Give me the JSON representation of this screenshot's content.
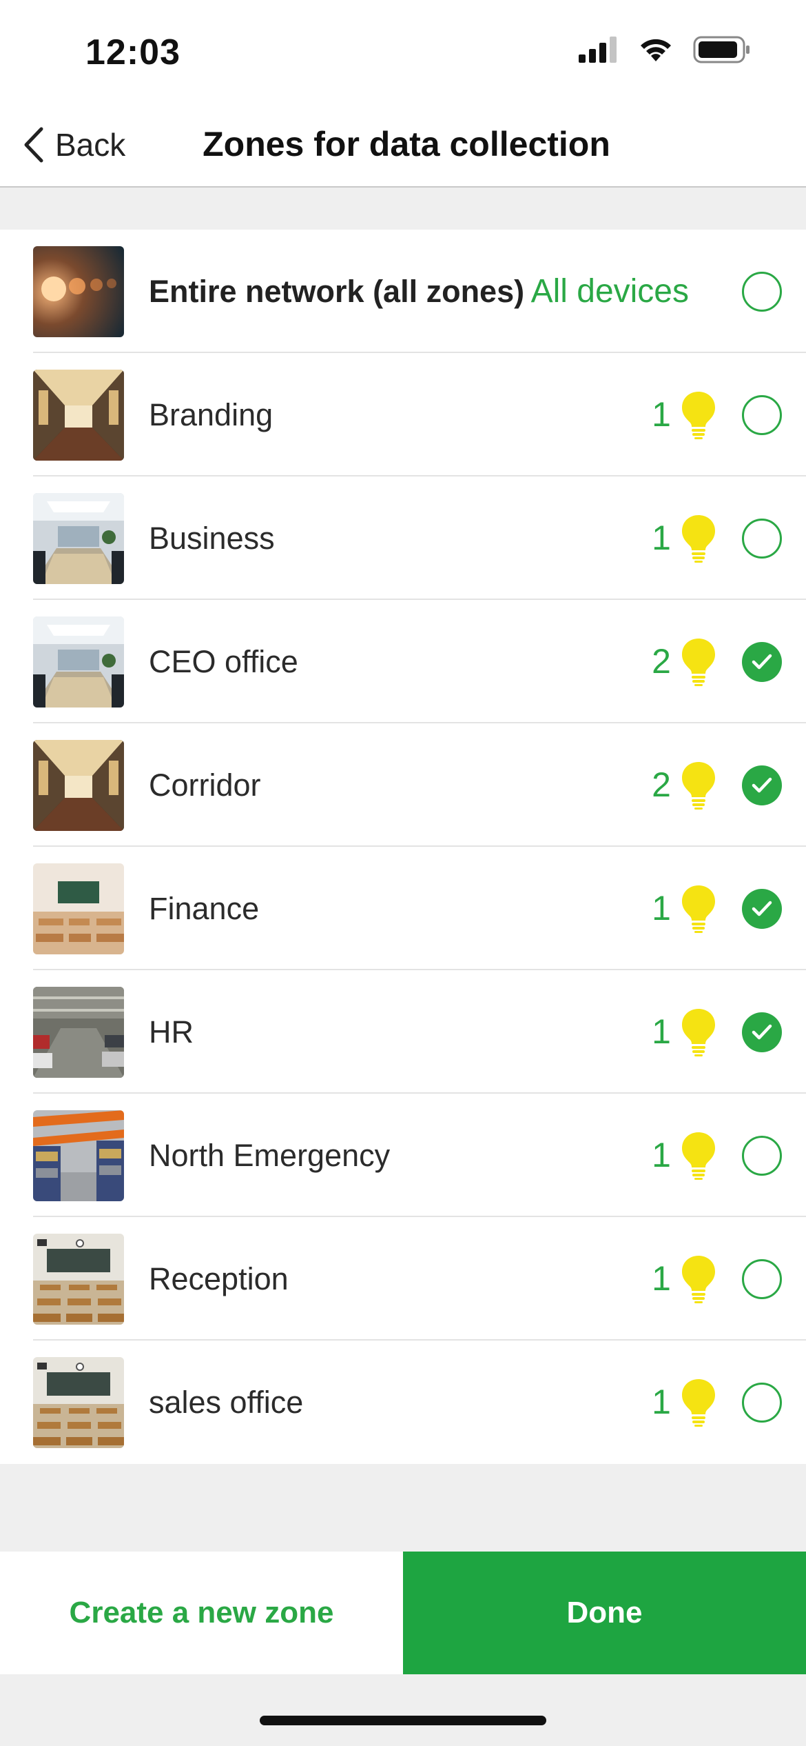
{
  "status_bar": {
    "time": "12:03"
  },
  "nav": {
    "back_label": "Back",
    "title": "Zones for data collection"
  },
  "entire_network": {
    "label": "Entire network (all zones)",
    "devices_label": "All devices",
    "selected": false,
    "thumb": "lights"
  },
  "zones": [
    {
      "name": "Branding",
      "count": "1",
      "selected": false,
      "thumb": "corridor"
    },
    {
      "name": "Business",
      "count": "1",
      "selected": false,
      "thumb": "boardroom"
    },
    {
      "name": "CEO office",
      "count": "2",
      "selected": true,
      "thumb": "boardroom"
    },
    {
      "name": "Corridor",
      "count": "2",
      "selected": true,
      "thumb": "corridor"
    },
    {
      "name": "Finance",
      "count": "1",
      "selected": true,
      "thumb": "classroom-light"
    },
    {
      "name": "HR",
      "count": "1",
      "selected": true,
      "thumb": "parking"
    },
    {
      "name": "North Emergency",
      "count": "1",
      "selected": false,
      "thumb": "warehouse"
    },
    {
      "name": "Reception",
      "count": "1",
      "selected": false,
      "thumb": "classroom"
    },
    {
      "name": "sales office",
      "count": "1",
      "selected": false,
      "thumb": "classroom"
    }
  ],
  "footer": {
    "create_label": "Create a new zone",
    "done_label": "Done"
  },
  "colors": {
    "accent": "#2aa845",
    "done_bg": "#1ea541",
    "bulb": "#f5e312"
  }
}
